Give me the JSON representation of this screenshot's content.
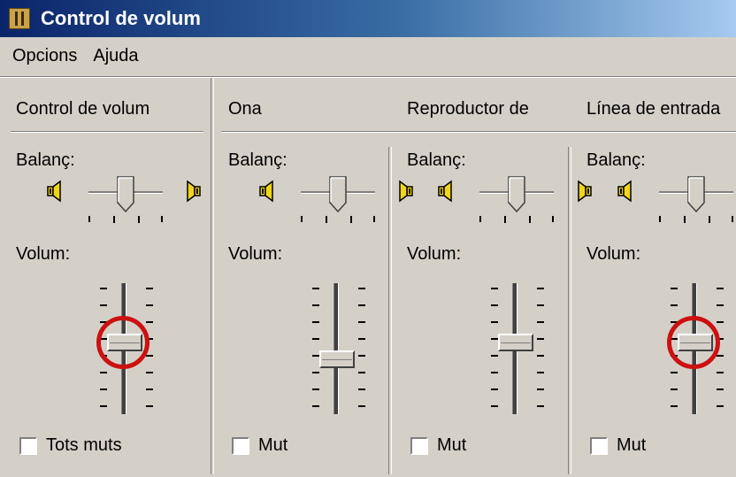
{
  "window": {
    "title": "Control de volum"
  },
  "menu": {
    "items": [
      "Opcions",
      "Ajuda"
    ]
  },
  "columns": [
    {
      "title": "Control de volum",
      "balance_label": "Balanç:",
      "volume_label": "Volum:",
      "checkbox_label": "Tots muts",
      "checked": false,
      "balance": 0.5,
      "volume": 0.6,
      "highlighted": true
    },
    {
      "title": "Ona",
      "balance_label": "Balanç:",
      "volume_label": "Volum:",
      "checkbox_label": "Mut",
      "checked": false,
      "balance": 0.5,
      "volume": 0.45,
      "highlighted": false
    },
    {
      "title": "Reproductor de",
      "balance_label": "Balanç:",
      "volume_label": "Volum:",
      "checkbox_label": "Mut",
      "checked": false,
      "balance": 0.5,
      "volume": 0.6,
      "highlighted": false
    },
    {
      "title": "Línea de entrada",
      "balance_label": "Balanç:",
      "volume_label": "Volum:",
      "checkbox_label": "Mut",
      "checked": false,
      "balance": 0.5,
      "volume": 0.6,
      "highlighted": true
    }
  ],
  "icons": {
    "left_speaker": "speaker-left-icon",
    "right_speaker": "speaker-right-icon",
    "app": "volume-control-icon"
  },
  "colors": {
    "titlebar_start": "#0a246a",
    "titlebar_end": "#a6caf0",
    "face": "#d4d0c8",
    "highlight_circle": "#cc1111"
  }
}
